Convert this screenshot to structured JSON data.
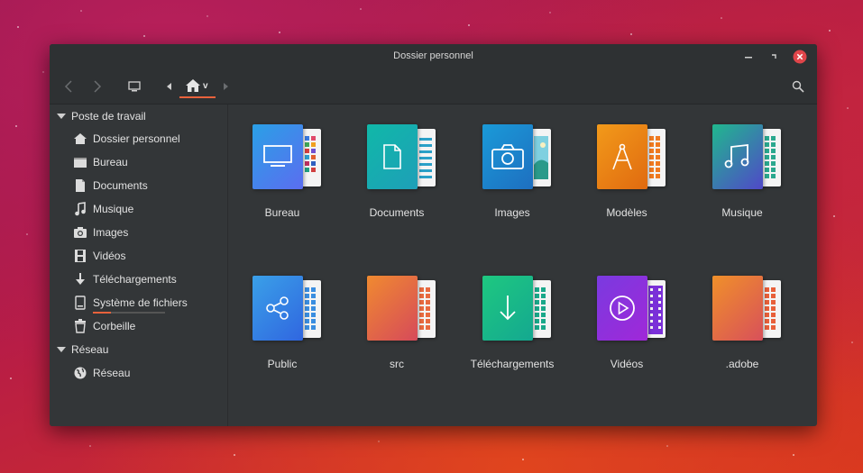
{
  "window": {
    "title": "Dossier personnel",
    "controls": {
      "minimize": "minimize",
      "maximize": "maximize",
      "close": "close"
    }
  },
  "toolbar": {
    "home_crumb_label": "v"
  },
  "sidebar": {
    "sections": [
      {
        "label": "Poste de travail"
      },
      {
        "label": "Réseau"
      }
    ],
    "items": [
      {
        "label": "Dossier personnel",
        "icon": "home-icon"
      },
      {
        "label": "Bureau",
        "icon": "desktop-folder-icon"
      },
      {
        "label": "Documents",
        "icon": "document-icon"
      },
      {
        "label": "Musique",
        "icon": "music-note-icon"
      },
      {
        "label": "Images",
        "icon": "camera-icon"
      },
      {
        "label": "Vidéos",
        "icon": "film-icon"
      },
      {
        "label": "Téléchargements",
        "icon": "download-arrow-icon"
      },
      {
        "label": "Système de fichiers",
        "icon": "drive-icon"
      },
      {
        "label": "Corbeille",
        "icon": "trash-icon"
      },
      {
        "label": "Réseau",
        "icon": "globe-icon"
      }
    ]
  },
  "folders": [
    {
      "label": "Bureau",
      "icon": "monitor-icon",
      "colors": [
        "#2aa0e6",
        "#5b6df0"
      ],
      "page_color": "mixed"
    },
    {
      "label": "Documents",
      "icon": "document-icon",
      "colors": [
        "#10b8a8",
        "#1e9fb8"
      ],
      "page_color": "#2aa0c8"
    },
    {
      "label": "Images",
      "icon": "camera-icon",
      "colors": [
        "#1a9ad8",
        "#1e6fc0"
      ],
      "page_color": "photo"
    },
    {
      "label": "Modèles",
      "icon": "compass-icon",
      "colors": [
        "#f29a1a",
        "#e06a10"
      ],
      "page_color": "#f07a20"
    },
    {
      "label": "Musique",
      "icon": "music-note-icon",
      "colors": [
        "#20b88e",
        "#5048c8"
      ],
      "page_color": "#2aa88e"
    },
    {
      "label": "Public",
      "icon": "share-icon",
      "colors": [
        "#3aa0e8",
        "#3066e0"
      ],
      "page_color": "#3a8ee0"
    },
    {
      "label": "src",
      "icon": "",
      "colors": [
        "#f08a30",
        "#d64a5a"
      ],
      "page_color": "#e86a40"
    },
    {
      "label": "Téléchargements",
      "icon": "download-arrow-icon",
      "colors": [
        "#1ec880",
        "#14a890"
      ],
      "page_color": "#1aa88a"
    },
    {
      "label": "Vidéos",
      "icon": "play-circle-icon",
      "colors": [
        "#7a3ae0",
        "#a028d8"
      ],
      "page_color": "#7a30d8"
    },
    {
      "label": ".adobe",
      "icon": "",
      "colors": [
        "#f0902a",
        "#d8505a"
      ],
      "page_color": "#e8603a"
    }
  ],
  "colors": {
    "accent": "#e8623c",
    "window_bg": "#333638",
    "close_button": "#e0454a"
  }
}
